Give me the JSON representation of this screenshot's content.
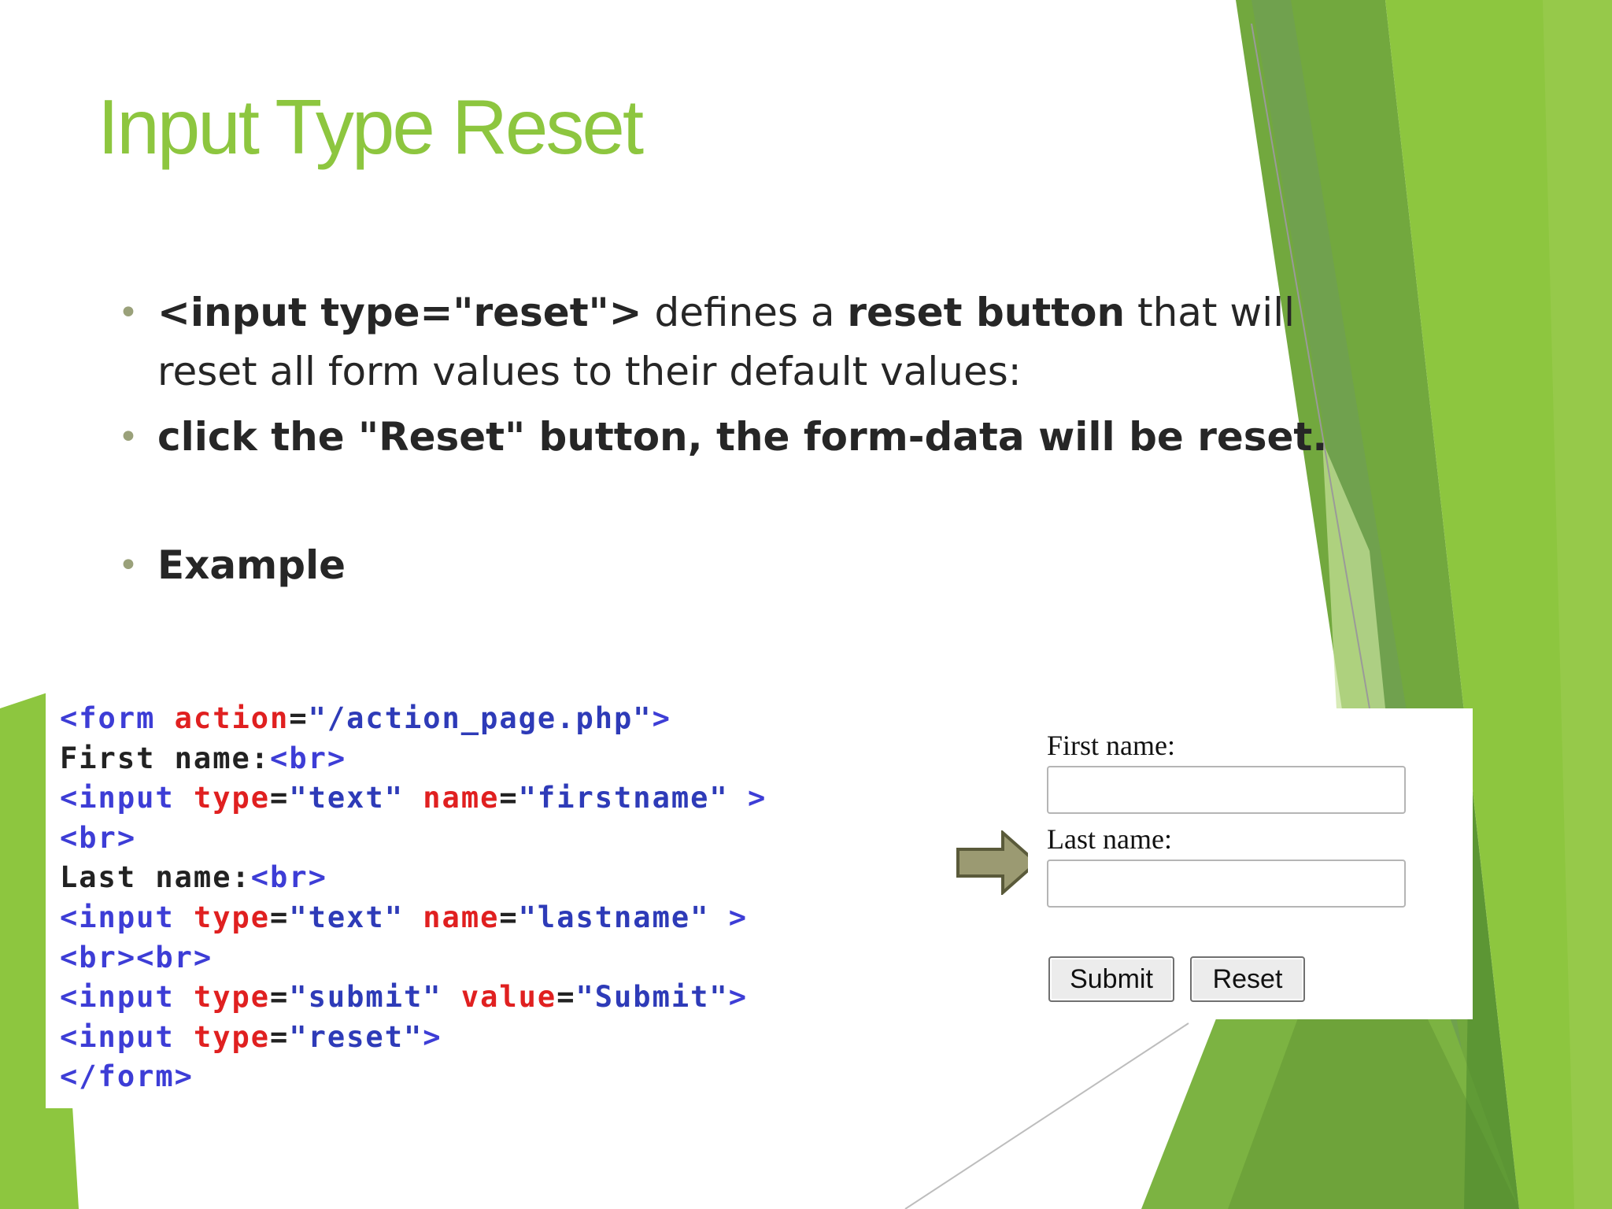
{
  "slide": {
    "title": "Input Type Reset",
    "bullets": [
      {
        "parts": [
          {
            "text": "<input type=\"reset\">",
            "bold": true
          },
          {
            "text": " defines a ",
            "bold": false
          },
          {
            "text": "reset button",
            "bold": true
          },
          {
            "text": " that will reset all form values to their default values:",
            "bold": false
          }
        ]
      },
      {
        "parts": [
          {
            "text": "click the \"Reset\" button, the form-data will be reset.",
            "bold": true
          }
        ]
      },
      {
        "parts": [
          {
            "text": "Example",
            "bold": true
          }
        ]
      }
    ]
  },
  "code": {
    "lines": [
      [
        {
          "text": "<form ",
          "c": "t"
        },
        {
          "text": "action",
          "c": "a"
        },
        {
          "text": "=",
          "c": "p"
        },
        {
          "text": "\"/action_page.php\"",
          "c": "v"
        },
        {
          "text": ">",
          "c": "t"
        }
      ],
      [
        {
          "text": "First name:",
          "c": "p"
        },
        {
          "text": "<br>",
          "c": "t"
        }
      ],
      [
        {
          "text": "<input ",
          "c": "t"
        },
        {
          "text": "type",
          "c": "a"
        },
        {
          "text": "=",
          "c": "p"
        },
        {
          "text": "\"text\" ",
          "c": "v"
        },
        {
          "text": "name",
          "c": "a"
        },
        {
          "text": "=",
          "c": "p"
        },
        {
          "text": "\"firstname\" ",
          "c": "v"
        },
        {
          "text": ">",
          "c": "t"
        }
      ],
      [
        {
          "text": "<br>",
          "c": "t"
        }
      ],
      [
        {
          "text": "Last name:",
          "c": "p"
        },
        {
          "text": "<br>",
          "c": "t"
        }
      ],
      [
        {
          "text": "<input ",
          "c": "t"
        },
        {
          "text": "type",
          "c": "a"
        },
        {
          "text": "=",
          "c": "p"
        },
        {
          "text": "\"text\" ",
          "c": "v"
        },
        {
          "text": "name",
          "c": "a"
        },
        {
          "text": "=",
          "c": "p"
        },
        {
          "text": "\"lastname\" ",
          "c": "v"
        },
        {
          "text": ">",
          "c": "t"
        }
      ],
      [
        {
          "text": "<br><br>",
          "c": "t"
        }
      ],
      [
        {
          "text": "<input ",
          "c": "t"
        },
        {
          "text": "type",
          "c": "a"
        },
        {
          "text": "=",
          "c": "p"
        },
        {
          "text": "\"submit\" ",
          "c": "v"
        },
        {
          "text": "value",
          "c": "a"
        },
        {
          "text": "=",
          "c": "p"
        },
        {
          "text": "\"Submit\"",
          "c": "v"
        },
        {
          "text": ">",
          "c": "t"
        }
      ],
      [
        {
          "text": "<input ",
          "c": "t"
        },
        {
          "text": "type",
          "c": "a"
        },
        {
          "text": "=",
          "c": "p"
        },
        {
          "text": "\"reset\"",
          "c": "v"
        },
        {
          "text": ">",
          "c": "t"
        }
      ],
      [
        {
          "text": "</form>",
          "c": "t"
        }
      ]
    ]
  },
  "form_preview": {
    "first_name_label": "First name:",
    "last_name_label": "Last name:",
    "first_name_value": "",
    "last_name_value": "",
    "submit_label": "Submit",
    "reset_label": "Reset"
  },
  "colors": {
    "title": "#8dc63f",
    "text": "#262626",
    "bullet": "#9aa17a",
    "code_tag": "#3d3dd6",
    "code_attr": "#e02020",
    "code_value": "#2e3bb8",
    "code_plain": "#222222",
    "arrow_fill": "#9b9a72",
    "arrow_stroke": "#5a5a3a",
    "green_light": "#8dc63f",
    "green_mid": "#72a83e",
    "green_dark": "#5c8a37"
  }
}
